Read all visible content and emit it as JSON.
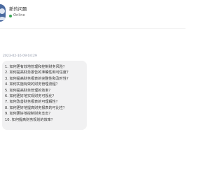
{
  "header": {
    "title": "新的问题",
    "status": "Online",
    "status_color": "#3aa655",
    "avatar_icon": "user-avatar-icon"
  },
  "message": {
    "timestamp": "2023-02-16 09:04:29",
    "questions": [
      "1. 如何更有效地管理和控制财务风险？",
      "2. 如何提高财务报告的准确性和可信度？",
      "3. 如何提高财务报表的完整性和及时性？",
      "4. 如何实施有效的财务管理流程？",
      "5. 如何提高财务管理的效率？",
      "6. 如何更好地实现财务可视化？",
      "7. 如何改善财务报表的可理解性？",
      "8. 如何更好地提高财务报表的可比性？",
      "9. 如何更好地控制财务支出？",
      "10. 如何提高财务规划的效率？"
    ]
  }
}
